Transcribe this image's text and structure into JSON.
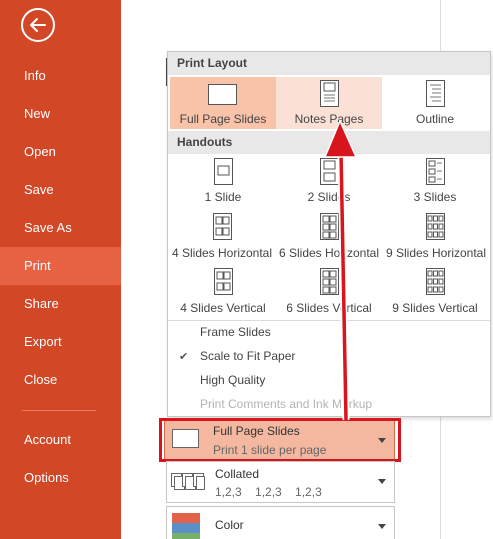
{
  "sidebar": {
    "items": [
      {
        "label": "Info"
      },
      {
        "label": "New"
      },
      {
        "label": "Open"
      },
      {
        "label": "Save"
      },
      {
        "label": "Save As"
      },
      {
        "label": "Print",
        "active": true
      },
      {
        "label": "Share"
      },
      {
        "label": "Export"
      },
      {
        "label": "Close"
      },
      {
        "label": "Account"
      },
      {
        "label": "Options"
      }
    ],
    "color": "#d24726",
    "active_color": "#e66242"
  },
  "layout_menu": {
    "print_layout_header": "Print Layout",
    "print_layout": [
      {
        "label": "Full Page Slides",
        "icon": "full-page-slide-icon",
        "state": "selected"
      },
      {
        "label": "Notes Pages",
        "icon": "notes-pages-icon",
        "state": "hover"
      },
      {
        "label": "Outline",
        "icon": "outline-icon",
        "state": "normal"
      }
    ],
    "handouts_header": "Handouts",
    "handouts": [
      {
        "label": "1 Slide",
        "icon": "handout-1-slide-icon"
      },
      {
        "label": "2 Slides",
        "icon": "handout-2-slides-icon"
      },
      {
        "label": "3 Slides",
        "icon": "handout-3-slides-icon"
      },
      {
        "label": "4 Slides Horizontal",
        "icon": "handout-4-horizontal-icon"
      },
      {
        "label": "6 Slides Horizontal",
        "icon": "handout-6-horizontal-icon"
      },
      {
        "label": "9 Slides Horizontal",
        "icon": "handout-9-horizontal-icon"
      },
      {
        "label": "4 Slides Vertical",
        "icon": "handout-4-vertical-icon"
      },
      {
        "label": "6 Slides Vertical",
        "icon": "handout-6-vertical-icon"
      },
      {
        "label": "9 Slides Vertical",
        "icon": "handout-9-vertical-icon"
      }
    ],
    "options": {
      "frame_slides": "Frame Slides",
      "scale_to_fit": "Scale to Fit Paper",
      "scale_checked": true,
      "high_quality": "High Quality",
      "print_comments": "Print Comments and Ink Markup"
    }
  },
  "settings": {
    "layout": {
      "title": "Full Page Slides",
      "subtitle": "Print 1 slide per page"
    },
    "collation": {
      "title": "Collated",
      "subtitle": "1,2,3    1,2,3    1,2,3"
    },
    "color": {
      "title": "Color"
    }
  },
  "annotation_color": "#d8141d"
}
